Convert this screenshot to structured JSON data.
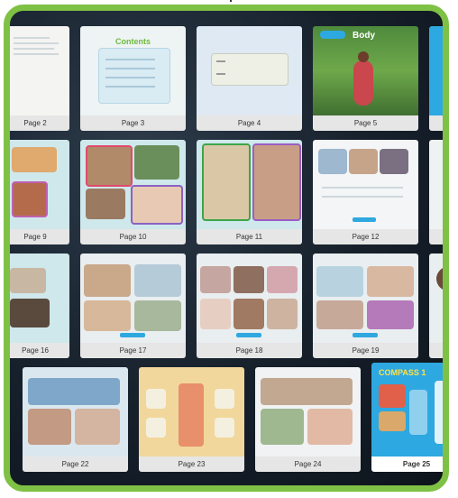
{
  "pages": [
    {
      "id": "p2",
      "label": "Page 2"
    },
    {
      "id": "p3",
      "label": "Page 3",
      "heading": "Contents"
    },
    {
      "id": "p4",
      "label": "Page 4"
    },
    {
      "id": "p5",
      "label": "Page 5",
      "heading": "Body"
    },
    {
      "id": "p9",
      "label": "Page 9"
    },
    {
      "id": "p10",
      "label": "Page 10"
    },
    {
      "id": "p11",
      "label": "Page 11"
    },
    {
      "id": "p12",
      "label": "Page 12"
    },
    {
      "id": "p16",
      "label": "Page 16"
    },
    {
      "id": "p17",
      "label": "Page 17"
    },
    {
      "id": "p18",
      "label": "Page 18"
    },
    {
      "id": "p19",
      "label": "Page 19"
    },
    {
      "id": "p22",
      "label": "Page 22"
    },
    {
      "id": "p23",
      "label": "Page 23"
    },
    {
      "id": "p24",
      "label": "Page 24"
    },
    {
      "id": "p25",
      "label": "Page 25",
      "heading": "COMPASS 1",
      "selected": true
    }
  ],
  "colors": {
    "frame": "#7ec145",
    "background": "#16202b",
    "caption": "#e6e6e6",
    "accent": "#2ea8e0"
  }
}
